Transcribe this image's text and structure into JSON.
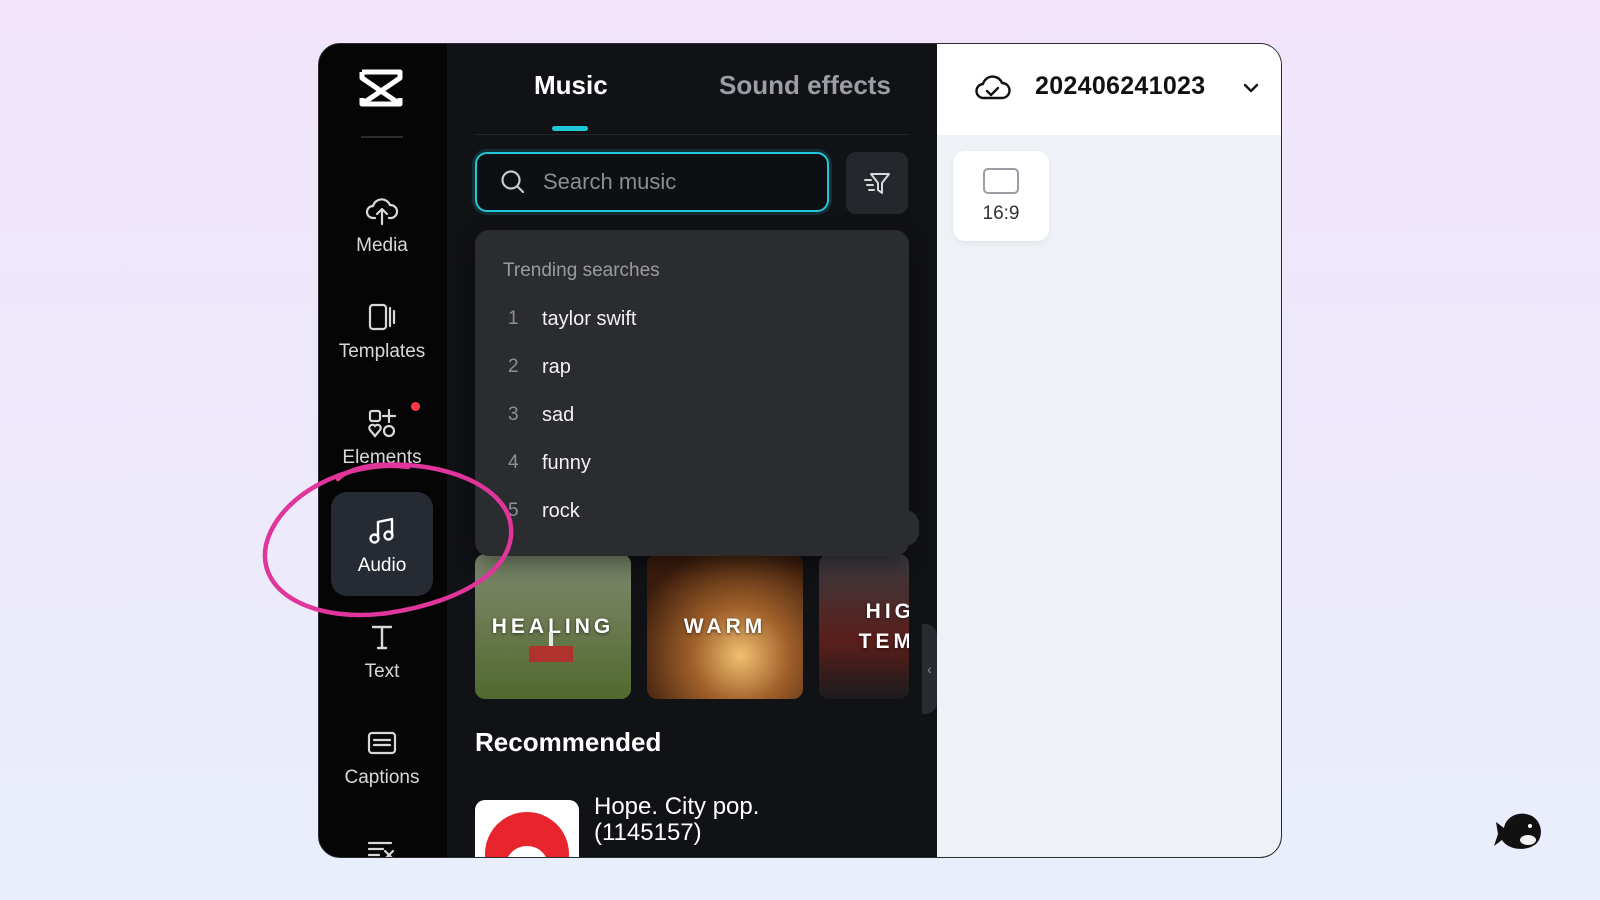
{
  "sidebar": {
    "items": [
      {
        "label": "Media",
        "icon": "cloud-upload-icon"
      },
      {
        "label": "Templates",
        "icon": "templates-icon"
      },
      {
        "label": "Elements",
        "icon": "elements-icon"
      },
      {
        "label": "Audio",
        "icon": "music-note-icon"
      },
      {
        "label": "Text",
        "icon": "text-icon"
      },
      {
        "label": "Captions",
        "icon": "captions-icon"
      }
    ],
    "active": "Audio"
  },
  "panel": {
    "tabs": [
      {
        "label": "Music"
      },
      {
        "label": "Sound effects"
      }
    ],
    "active_tab": "Music",
    "search": {
      "placeholder": "Search music",
      "value": ""
    },
    "trending": {
      "title": "Trending searches",
      "items": [
        {
          "num": "1",
          "text": "taylor swift"
        },
        {
          "num": "2",
          "text": "rap"
        },
        {
          "num": "3",
          "text": "sad"
        },
        {
          "num": "4",
          "text": "funny"
        },
        {
          "num": "5",
          "text": "rock"
        }
      ]
    },
    "categories": [
      {
        "label": "HEALING"
      },
      {
        "label": "WARM"
      },
      {
        "label_line1": "HIG",
        "label_line2": "TEM"
      }
    ],
    "recommended": {
      "title": "Recommended",
      "first_track": "Hope. City pop. (1145157)"
    }
  },
  "right": {
    "project_name": "202406241023",
    "ratio": "16:9"
  },
  "colors": {
    "accent": "#1ec6d8",
    "annotation": "#e0359a",
    "notification": "#ff3b46"
  }
}
